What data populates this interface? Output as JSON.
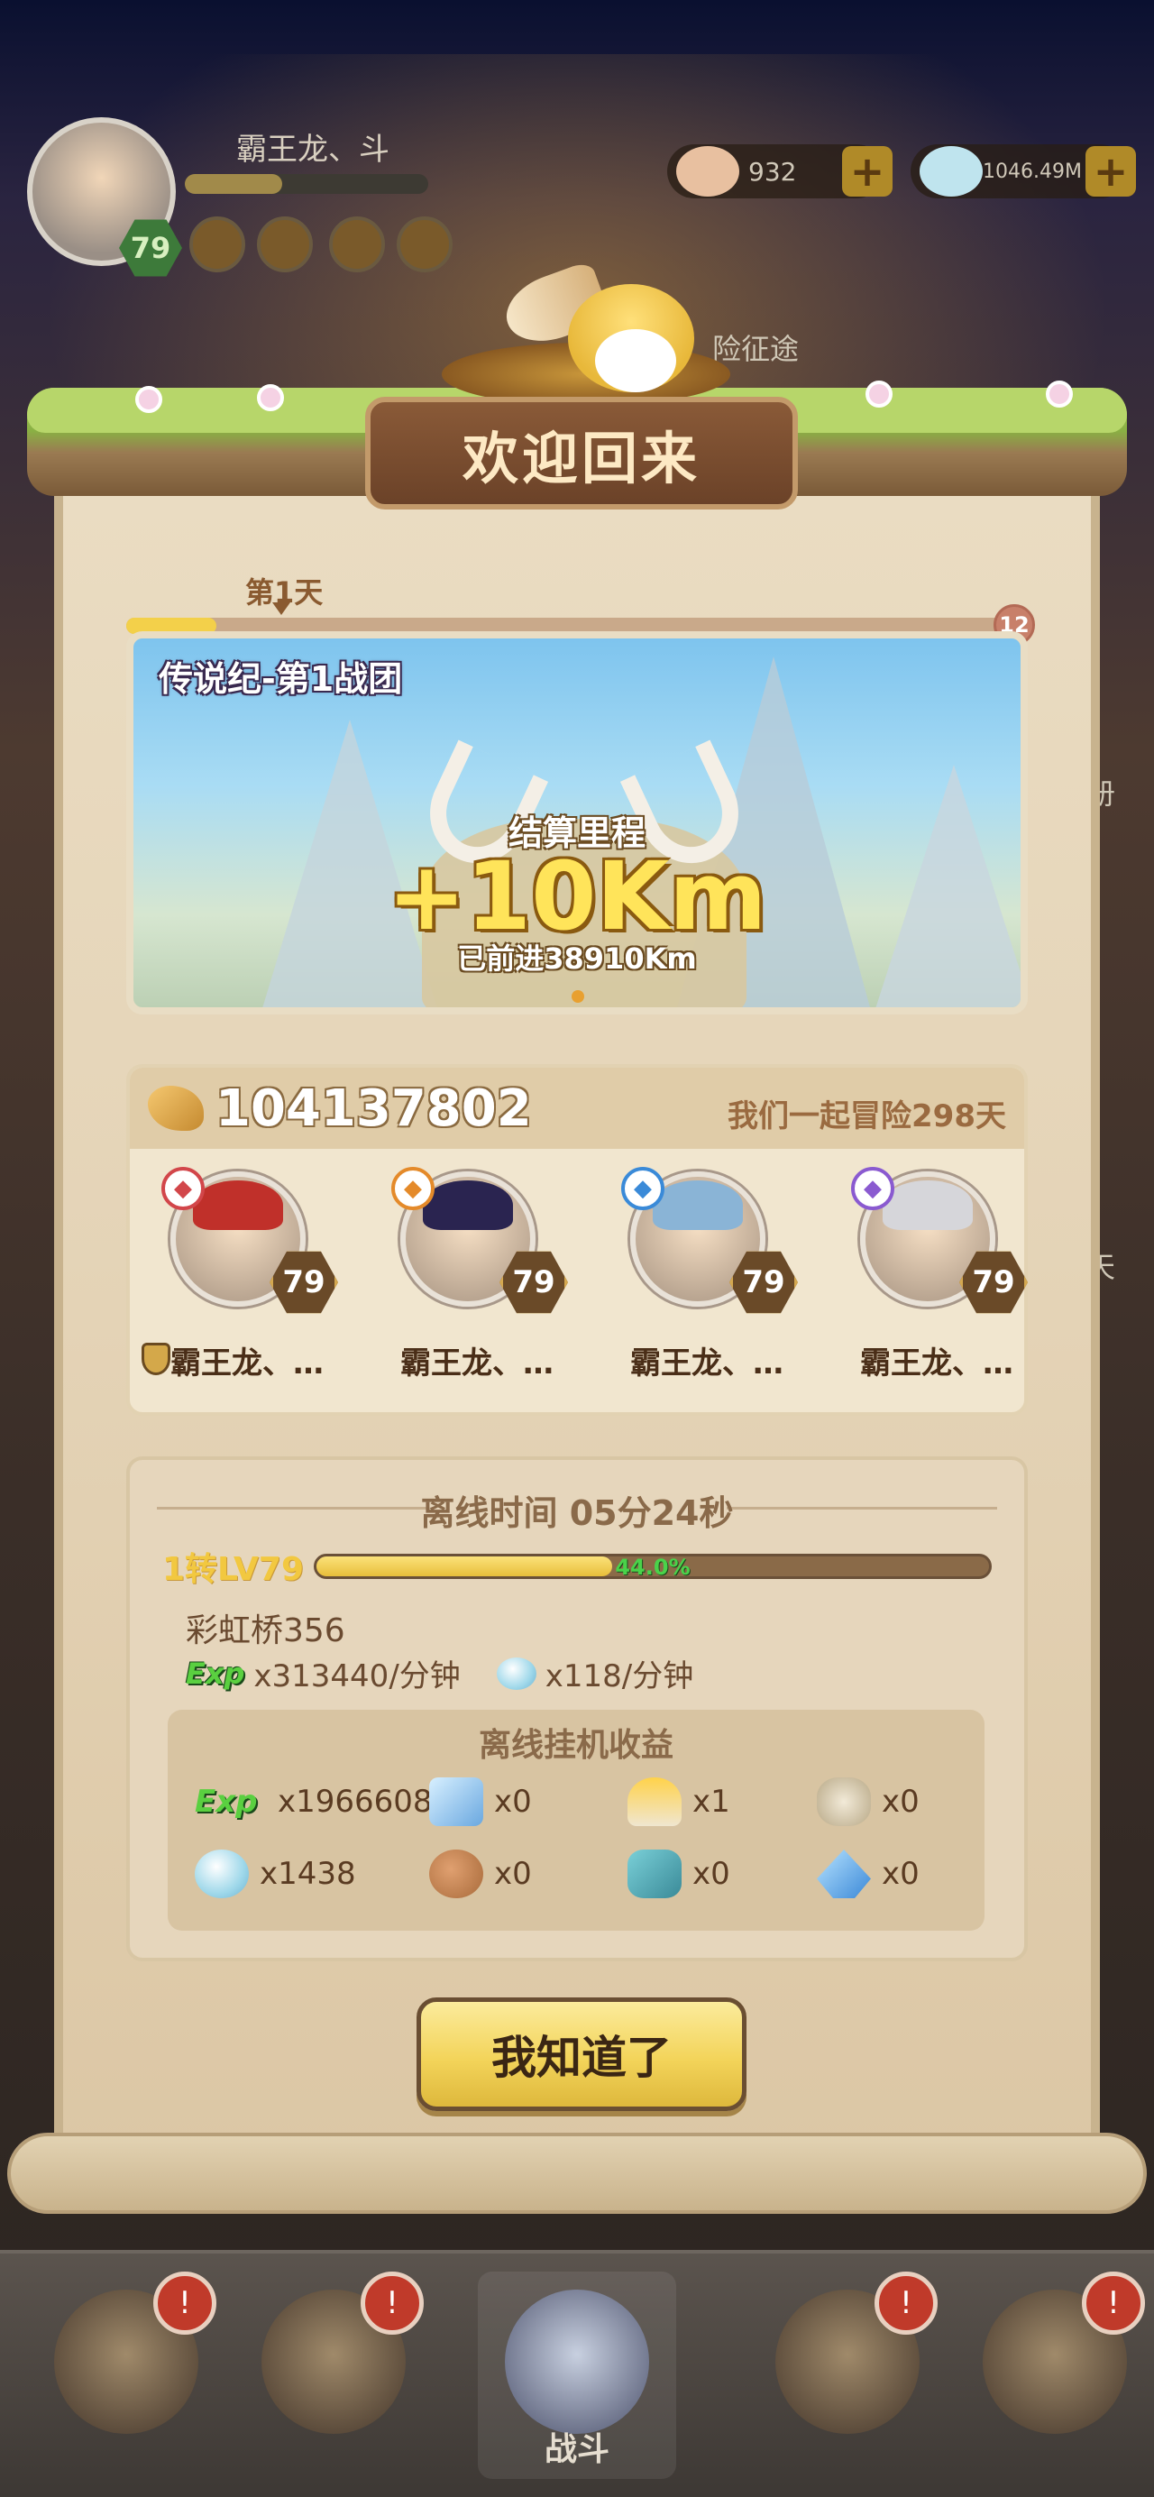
{
  "background": {
    "player_name": "霸王龙、斗",
    "player_level": "79",
    "resource_1": "932",
    "resource_2": "1046.49M",
    "side_label_journey": "险征途",
    "side_label_book": "册",
    "side_label_day": "天",
    "side_label_battle": "战斗"
  },
  "dialog": {
    "title": "欢迎回来",
    "day_label": "第1天",
    "day_progress_fraction": 0.1,
    "day_end_value": "12",
    "banner": {
      "team_title": "传说纪-第1战团",
      "mileage_label": "结算里程",
      "mileage_value": "+10Km",
      "mileage_total": "已前进38910Km"
    },
    "team": {
      "power_value": "104137802",
      "days_text": "我们一起冒险298天",
      "heroes": [
        {
          "name": "霸王龙、…",
          "level": "79",
          "element_color": "#d2464a",
          "hair_color": "#c0302a"
        },
        {
          "name": "霸王龙、…",
          "level": "79",
          "element_color": "#e48a2a",
          "hair_color": "#2a2450"
        },
        {
          "name": "霸王龙、…",
          "level": "79",
          "element_color": "#3a8ad8",
          "hair_color": "#8ab4d6"
        },
        {
          "name": "霸王龙、…",
          "level": "79",
          "element_color": "#8a5ad0",
          "hair_color": "#d6d6da"
        }
      ]
    },
    "offline": {
      "title": "离线时间 05分24秒",
      "level_label": "1转LV79",
      "level_progress_text": "44.0%",
      "level_progress_fraction": 0.44,
      "stage_name": "彩虹桥356",
      "exp_tag": "Exp",
      "exp_rate": "x313440/分钟",
      "gem_rate": "x118/分钟",
      "rewards_title": "离线挂机收益",
      "rewards": [
        {
          "icon": "exp-icon",
          "value": "x1966608"
        },
        {
          "icon": "crystal-box-icon",
          "value": "x0"
        },
        {
          "icon": "candle-icon",
          "value": "x1"
        },
        {
          "icon": "stone-tablet-icon",
          "value": "x0"
        },
        {
          "icon": "gem-icon",
          "value": "x1438"
        },
        {
          "icon": "meat-icon",
          "value": "x0"
        },
        {
          "icon": "ore-icon",
          "value": "x0"
        },
        {
          "icon": "blue-crystal-icon",
          "value": "x0"
        }
      ]
    },
    "confirm_label": "我知道了"
  }
}
